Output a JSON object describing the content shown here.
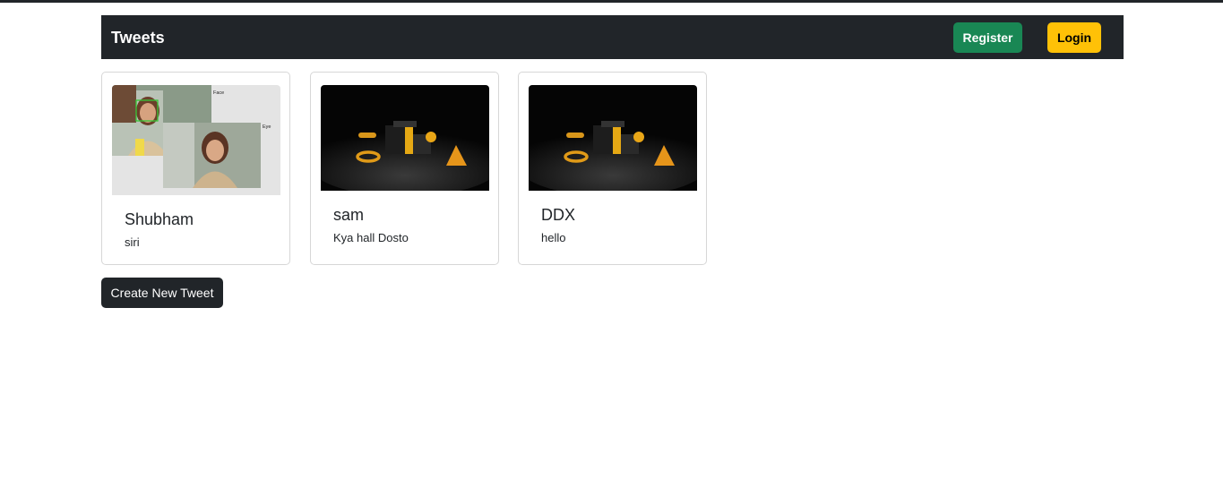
{
  "navbar": {
    "brand": "Tweets",
    "register_label": "Register",
    "login_label": "Login"
  },
  "tweets": [
    {
      "title": "Shubham",
      "text": "siri",
      "image": "face-detection-photo",
      "image_labels": [
        "Face",
        "Eye"
      ]
    },
    {
      "title": "sam",
      "text": "Kya hall Dosto",
      "image": "3d-shapes-render"
    },
    {
      "title": "DDX",
      "text": "hello",
      "image": "3d-shapes-render"
    }
  ],
  "actions": {
    "create_label": "Create New Tweet"
  },
  "colors": {
    "navbar_bg": "#212529",
    "register_bg": "#198754",
    "login_bg": "#ffc107",
    "card_border": "#d7d7d7"
  }
}
